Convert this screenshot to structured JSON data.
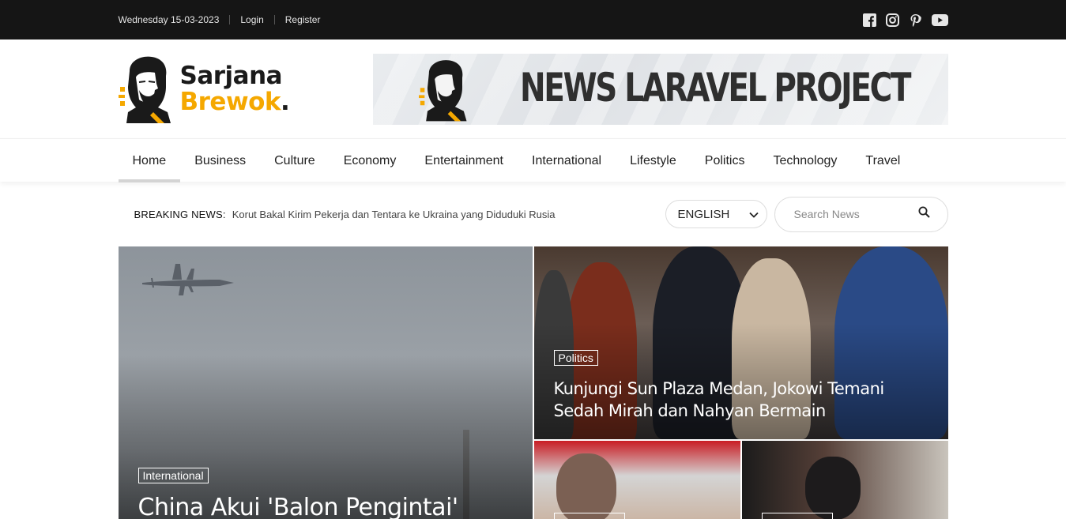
{
  "topbar": {
    "date": "Wednesday 15-03-2023",
    "login": "Login",
    "register": "Register",
    "social_icons": [
      "facebook-icon",
      "instagram-icon",
      "pinterest-icon",
      "youtube-icon"
    ]
  },
  "logo": {
    "line1": "Sarjana",
    "line2": "Brewok",
    "dot": "."
  },
  "banner": {
    "text": "NEWS LARAVEL PROJECT"
  },
  "nav": {
    "items": [
      "Home",
      "Business",
      "Culture",
      "Economy",
      "Entertainment",
      "International",
      "Lifestyle",
      "Politics",
      "Technology",
      "Travel"
    ],
    "active": "Home"
  },
  "breaking": {
    "label": "BREAKING NEWS:",
    "headline": "Korut Bakal Kirim Pekerja dan Tentara ke Ukraina yang Diduduki Rusia"
  },
  "language": {
    "selected": "ENGLISH"
  },
  "search": {
    "placeholder": "Search News"
  },
  "featured": {
    "main": {
      "category": "International",
      "title": "China Akui 'Balon Pengintai'"
    },
    "top_right": {
      "category": "Politics",
      "title": "Kunjungi Sun Plaza Medan, Jokowi Temani Sedah Mirah dan Nahyan Bermain"
    }
  },
  "colors": {
    "topbar_bg": "#151515",
    "brand_accent": "#f5a800",
    "text_dark": "#222222"
  }
}
